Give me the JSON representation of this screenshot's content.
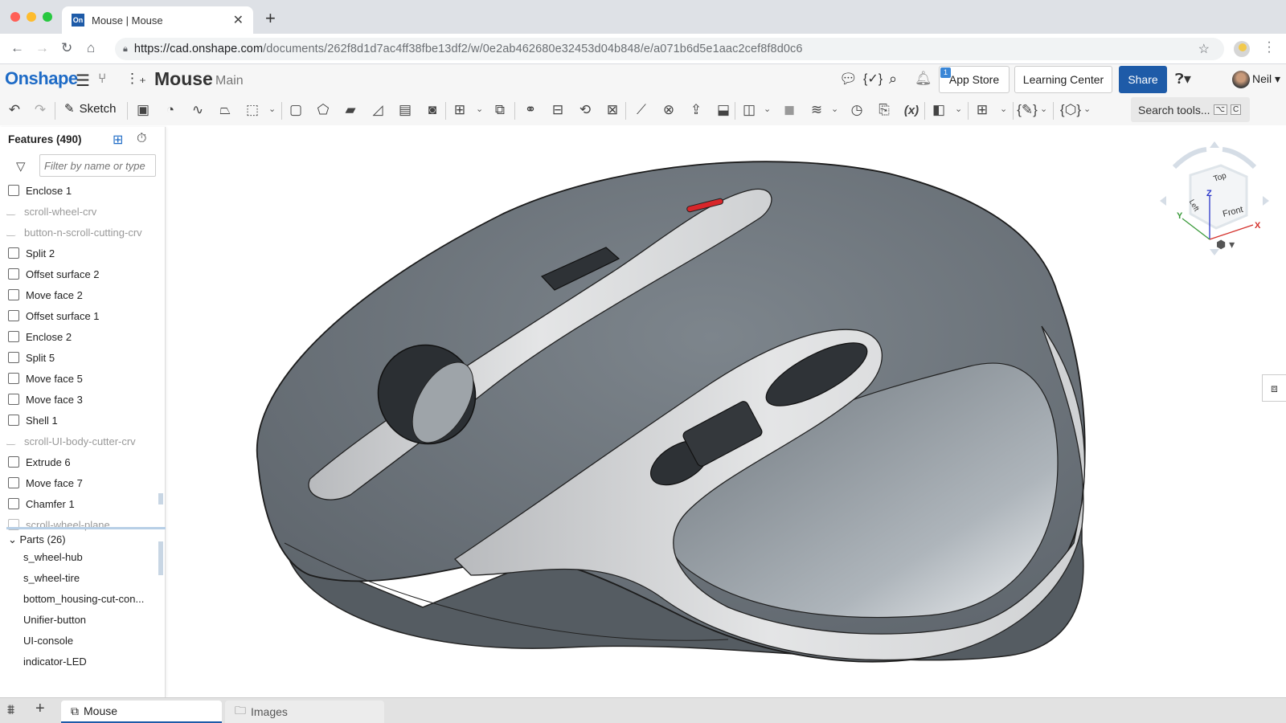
{
  "browser": {
    "tab_title": "Mouse | Mouse",
    "tab_favicon": "On",
    "url_host": "https://cad.onshape.com",
    "url_path": "/documents/262f8d1d7ac4ff38fbe13df2/w/0e2ab462680e32453d04b848/e/a071b6d5e1aac2cef8f8d0c6"
  },
  "header": {
    "logo": "Onshape",
    "doc_title": "Mouse",
    "branch": "Main",
    "notification_count": "1",
    "app_store": "App Store",
    "learning_center": "Learning Center",
    "share": "Share",
    "user": "Neil"
  },
  "toolbar": {
    "sketch": "Sketch",
    "search_placeholder": "Search tools...",
    "search_kbd1": "⌥",
    "search_kbd2": "C"
  },
  "features": {
    "title": "Features (490)",
    "filter_placeholder": "Filter by name or type",
    "items": [
      {
        "label": "Enclose 1",
        "icon": "enclose-icon",
        "dim": false
      },
      {
        "label": "scroll-wheel-crv",
        "icon": "sketch-icon",
        "dim": true
      },
      {
        "label": "button-n-scroll-cutting-crv",
        "icon": "sketch-icon",
        "dim": true
      },
      {
        "label": "Split 2",
        "icon": "split-icon",
        "dim": false
      },
      {
        "label": "Offset surface 2",
        "icon": "offset-surface-icon",
        "dim": false
      },
      {
        "label": "Move face 2",
        "icon": "move-face-icon",
        "dim": false
      },
      {
        "label": "Offset surface 1",
        "icon": "offset-surface-icon",
        "dim": false
      },
      {
        "label": "Enclose 2",
        "icon": "enclose-icon",
        "dim": false
      },
      {
        "label": "Split 5",
        "icon": "split-icon",
        "dim": false
      },
      {
        "label": "Move face 5",
        "icon": "move-face-icon",
        "dim": false
      },
      {
        "label": "Move face 3",
        "icon": "move-face-icon",
        "dim": false
      },
      {
        "label": "Shell 1",
        "icon": "shell-icon",
        "dim": false
      },
      {
        "label": "scroll-UI-body-cutter-crv",
        "icon": "sketch-icon",
        "dim": true
      },
      {
        "label": "Extrude 6",
        "icon": "extrude-icon",
        "dim": false
      },
      {
        "label": "Move face 7",
        "icon": "move-face-icon",
        "dim": false
      },
      {
        "label": "Chamfer 1",
        "icon": "chamfer-icon",
        "dim": false
      },
      {
        "label": "scroll-wheel-plane",
        "icon": "plane-icon",
        "dim": true
      }
    ]
  },
  "parts": {
    "title": "Parts (26)",
    "items": [
      "s_wheel-hub",
      "s_wheel-tire",
      "bottom_housing-cut-con...",
      "Unifier-button",
      "UI-console",
      "indicator-LED"
    ]
  },
  "viewcube": {
    "faces": {
      "top": "Top",
      "left": "Left",
      "front": "Front"
    },
    "axes": {
      "x": "X",
      "y": "Y",
      "z": "Z"
    }
  },
  "bottom_tabs": [
    {
      "label": "Mouse",
      "active": true
    },
    {
      "label": "Images",
      "active": false
    }
  ],
  "colors": {
    "brand": "#1e5ba8",
    "body_gray": "#6e767d",
    "trim_white": "#d8d9da",
    "led_red": "#d8262a"
  }
}
